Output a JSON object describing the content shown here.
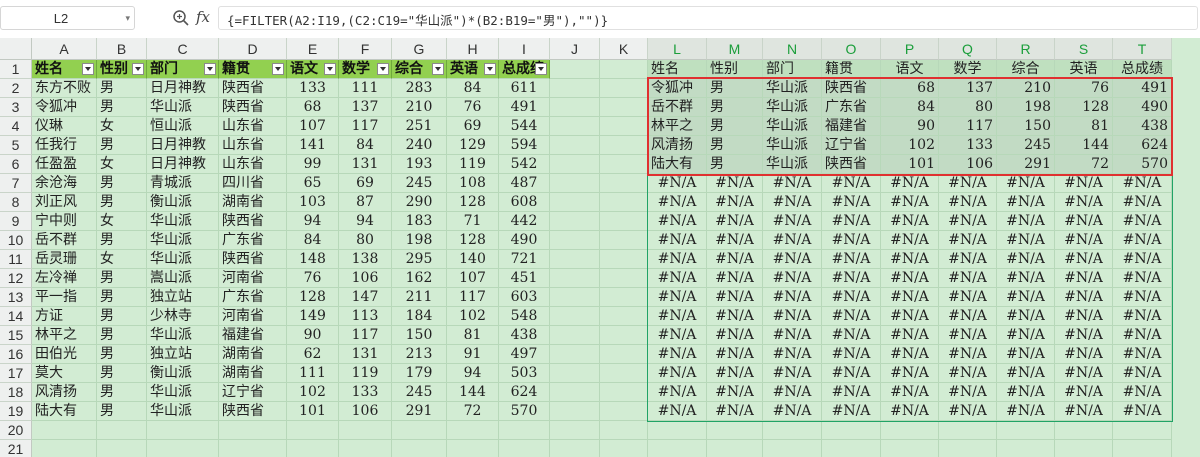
{
  "formula_bar": {
    "name_box": "L2",
    "formula": "{=FILTER(A2:I19,(C2:C19=\"华山派\")*(B2:B19=\"男\"),\"\")}"
  },
  "columns": [
    "A",
    "B",
    "C",
    "D",
    "E",
    "F",
    "G",
    "H",
    "I",
    "J",
    "K",
    "L",
    "M",
    "N",
    "O",
    "P",
    "Q",
    "R",
    "S",
    "T"
  ],
  "row_numbers": [
    "1",
    "2",
    "3",
    "4",
    "5",
    "6",
    "7",
    "8",
    "9",
    "10",
    "11",
    "12",
    "13",
    "14",
    "15",
    "16",
    "17",
    "18",
    "19",
    "20",
    "21"
  ],
  "source_table": {
    "headers": [
      "姓名",
      "性别",
      "部门",
      "籍贯",
      "语文",
      "数学",
      "综合",
      "英语",
      "总成绩"
    ],
    "rows": [
      [
        "东方不败",
        "男",
        "日月神教",
        "陕西省",
        "133",
        "111",
        "283",
        "84",
        "611"
      ],
      [
        "令狐冲",
        "男",
        "华山派",
        "陕西省",
        "68",
        "137",
        "210",
        "76",
        "491"
      ],
      [
        "仪琳",
        "女",
        "恒山派",
        "山东省",
        "107",
        "117",
        "251",
        "69",
        "544"
      ],
      [
        "任我行",
        "男",
        "日月神教",
        "山东省",
        "141",
        "84",
        "240",
        "129",
        "594"
      ],
      [
        "任盈盈",
        "女",
        "日月神教",
        "山东省",
        "99",
        "131",
        "193",
        "119",
        "542"
      ],
      [
        "余沧海",
        "男",
        "青城派",
        "四川省",
        "65",
        "69",
        "245",
        "108",
        "487"
      ],
      [
        "刘正风",
        "男",
        "衡山派",
        "湖南省",
        "103",
        "87",
        "290",
        "128",
        "608"
      ],
      [
        "宁中则",
        "女",
        "华山派",
        "陕西省",
        "94",
        "94",
        "183",
        "71",
        "442"
      ],
      [
        "岳不群",
        "男",
        "华山派",
        "广东省",
        "84",
        "80",
        "198",
        "128",
        "490"
      ],
      [
        "岳灵珊",
        "女",
        "华山派",
        "陕西省",
        "148",
        "138",
        "295",
        "140",
        "721"
      ],
      [
        "左冷禅",
        "男",
        "嵩山派",
        "河南省",
        "76",
        "106",
        "162",
        "107",
        "451"
      ],
      [
        "平一指",
        "男",
        "独立站",
        "广东省",
        "128",
        "147",
        "211",
        "117",
        "603"
      ],
      [
        "方证",
        "男",
        "少林寺",
        "河南省",
        "149",
        "113",
        "184",
        "102",
        "548"
      ],
      [
        "林平之",
        "男",
        "华山派",
        "福建省",
        "90",
        "117",
        "150",
        "81",
        "438"
      ],
      [
        "田伯光",
        "男",
        "独立站",
        "湖南省",
        "62",
        "131",
        "213",
        "91",
        "497"
      ],
      [
        "莫大",
        "男",
        "衡山派",
        "湖南省",
        "111",
        "119",
        "179",
        "94",
        "503"
      ],
      [
        "风清扬",
        "男",
        "华山派",
        "辽宁省",
        "102",
        "133",
        "245",
        "144",
        "624"
      ],
      [
        "陆大有",
        "男",
        "华山派",
        "陕西省",
        "101",
        "106",
        "291",
        "72",
        "570"
      ]
    ]
  },
  "result_table": {
    "headers": [
      "姓名",
      "性别",
      "部门",
      "籍贯",
      "语文",
      "数学",
      "综合",
      "英语",
      "总成绩"
    ],
    "rows": [
      [
        "令狐冲",
        "男",
        "华山派",
        "陕西省",
        "68",
        "137",
        "210",
        "76",
        "491"
      ],
      [
        "岳不群",
        "男",
        "华山派",
        "广东省",
        "84",
        "80",
        "198",
        "128",
        "490"
      ],
      [
        "林平之",
        "男",
        "华山派",
        "福建省",
        "90",
        "117",
        "150",
        "81",
        "438"
      ],
      [
        "风清扬",
        "男",
        "华山派",
        "辽宁省",
        "102",
        "133",
        "245",
        "144",
        "624"
      ],
      [
        "陆大有",
        "男",
        "华山派",
        "陕西省",
        "101",
        "106",
        "291",
        "72",
        "570"
      ]
    ],
    "error_value": "#N/A"
  },
  "colors": {
    "header_fill": "#92d050",
    "grid_fill": "#d2ecd3",
    "highlight_border": "#e03030",
    "selected_header": "#1a9e3a"
  },
  "icons": {
    "zoom": "zoom-icon",
    "fx": "fx-icon"
  },
  "fx_label": "fx"
}
